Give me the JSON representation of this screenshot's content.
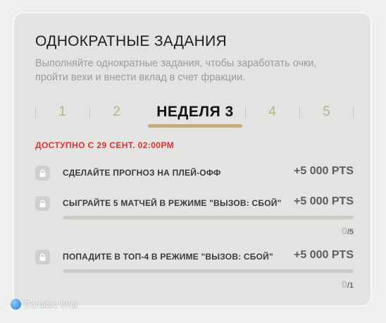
{
  "header": {
    "title": "ОДНОКРАТНЫЕ ЗАДАНИЯ",
    "subtitle": "Выполняйте однократные задания, чтобы заработать очки, пройти вехи и внести вклад в счет фракции."
  },
  "tabs": [
    {
      "label": "1",
      "active": false
    },
    {
      "label": "2",
      "active": false
    },
    {
      "label": "НЕДЕЛЯ 3",
      "active": true
    },
    {
      "label": "4",
      "active": false
    },
    {
      "label": "5",
      "active": false
    }
  ],
  "availability": "ДОСТУПНО С 29 СЕНТ. 02:00PM",
  "tasks": [
    {
      "label": "СДЕЛАЙТЕ ПРОГНОЗ НА ПЛЕЙ-ОФФ",
      "points": "+5 000 PTS",
      "locked": true
    },
    {
      "label": "СЫГРАЙТЕ 5 МАТЧЕЙ В РЕЖИМЕ \"ВЫЗОВ: СБОЙ\"",
      "points": "+5 000 PTS",
      "locked": true,
      "progress": {
        "current": "0",
        "total": "/5",
        "fraction": 0
      }
    },
    {
      "label": "ПОПАДИТЕ В ТОП-4 В РЕЖИМЕ \"ВЫЗОВ: СБОЙ\"",
      "points": "+5 000 PTS",
      "locked": true,
      "progress": {
        "current": "0",
        "total": "/1",
        "fraction": 0
      }
    }
  ],
  "watermark": {
    "name": "Donatov",
    "suffix": "blog",
    "icon": "globe-icon"
  },
  "colors": {
    "accent": "#c2ae7c",
    "availability": "#d8302c",
    "card": "#e3e4e2"
  }
}
